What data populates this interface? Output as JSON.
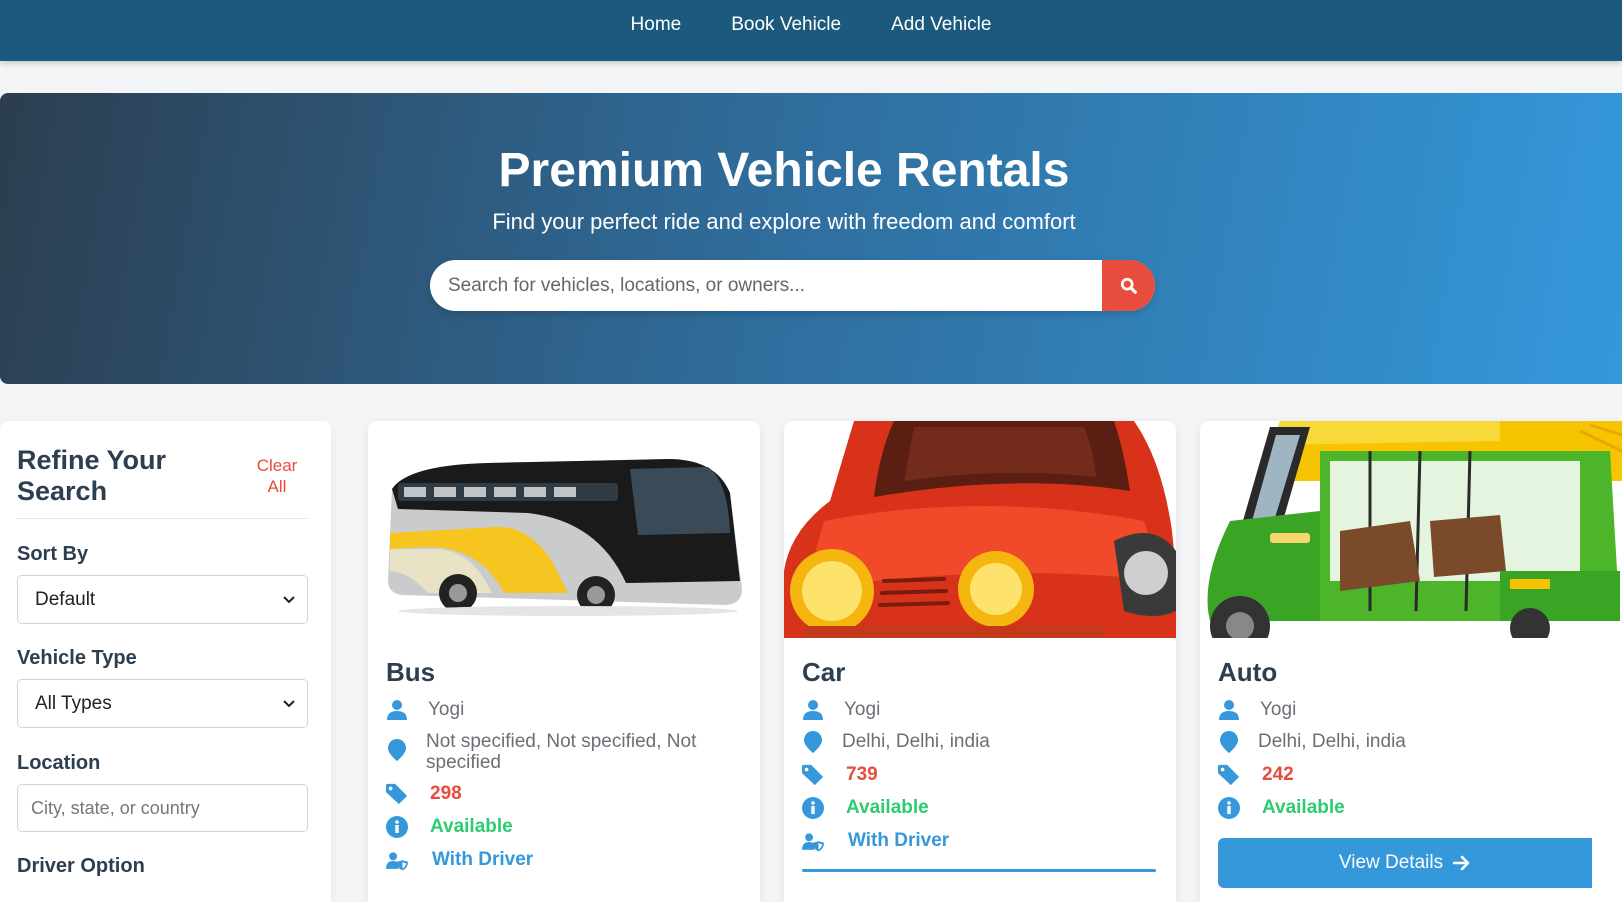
{
  "nav": {
    "home": "Home",
    "book": "Book Vehicle",
    "add": "Add Vehicle"
  },
  "hero": {
    "title": "Premium Vehicle Rentals",
    "subtitle": "Find your perfect ride and explore with freedom and comfort",
    "search_placeholder": "Search for vehicles, locations, or owners..."
  },
  "filters": {
    "title": "Refine Your Search",
    "clear_label": "Clear All",
    "sort_label": "Sort By",
    "sort_value": "Default",
    "type_label": "Vehicle Type",
    "type_value": "All Types",
    "location_label": "Location",
    "location_placeholder": "City, state, or country",
    "driver_label": "Driver Option"
  },
  "vehicles": [
    {
      "type": "Bus",
      "owner": "Yogi",
      "location": "Not specified, Not specified, Not specified",
      "price": "298",
      "status": "Available",
      "driver": "With Driver"
    },
    {
      "type": "Car",
      "owner": "Yogi",
      "location": "Delhi, Delhi, india",
      "price": "739",
      "status": "Available",
      "driver": "With Driver"
    },
    {
      "type": "Auto",
      "owner": "Yogi",
      "location": "Delhi, Delhi, india",
      "price": "242",
      "status": "Available",
      "view_label": "View Details"
    }
  ],
  "colors": {
    "nav": "#1c5a7d",
    "accent": "#3498db",
    "danger": "#e74c3c",
    "success": "#2ecc71",
    "heading": "#2c3e50"
  },
  "icons": [
    "search-icon",
    "user-icon",
    "map-marker-icon",
    "price-tag-icon",
    "info-icon",
    "user-shield-icon",
    "arrow-right-icon",
    "chevron-down-icon"
  ]
}
